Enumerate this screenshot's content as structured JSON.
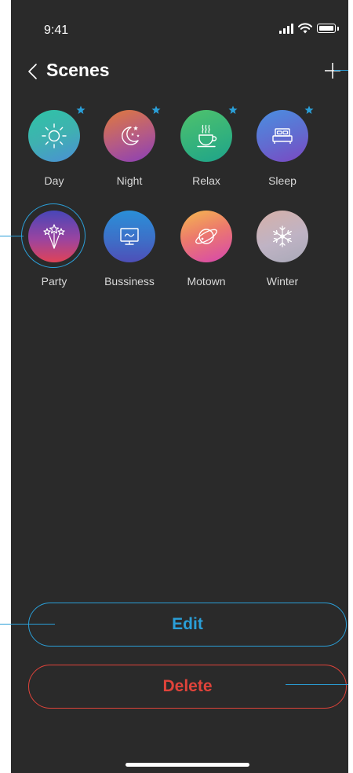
{
  "status_bar": {
    "time": "9:41"
  },
  "header": {
    "title": "Scenes"
  },
  "scenes": [
    {
      "label": "Day",
      "icon": "sun-icon",
      "favorite": true,
      "gradient": [
        "#2ec4a6",
        "#4b8fd6"
      ]
    },
    {
      "label": "Night",
      "icon": "moon-stars-icon",
      "favorite": true,
      "gradient": [
        "#e07a3c",
        "#8a3fb8"
      ]
    },
    {
      "label": "Relax",
      "icon": "hot-cup-icon",
      "favorite": true,
      "gradient": [
        "#4fc26c",
        "#1ea38b"
      ]
    },
    {
      "label": "Sleep",
      "icon": "bed-icon",
      "favorite": true,
      "gradient": [
        "#4a8fe0",
        "#7b48c2"
      ]
    },
    {
      "label": "Party",
      "icon": "fireworks-icon",
      "favorite": false,
      "selected": true,
      "gradient": [
        "#4846b8",
        "#e04357"
      ]
    },
    {
      "label": "Bussiness",
      "icon": "monitor-icon",
      "favorite": false,
      "gradient": [
        "#2a8fd8",
        "#4e4fb8"
      ]
    },
    {
      "label": "Motown",
      "icon": "planet-icon",
      "favorite": false,
      "gradient": [
        "#f08a56",
        "#d646b0"
      ]
    },
    {
      "label": "Winter",
      "icon": "snowflake-icon",
      "favorite": false,
      "gradient": [
        "#c8b6c0",
        "#a9a9b8"
      ]
    }
  ],
  "actions": {
    "edit_label": "Edit",
    "delete_label": "Delete"
  },
  "colors": {
    "background": "#2a2a2a",
    "accent": "#2a9fd8",
    "danger": "#e0433a",
    "favorite_star": "#2a9fd8"
  }
}
